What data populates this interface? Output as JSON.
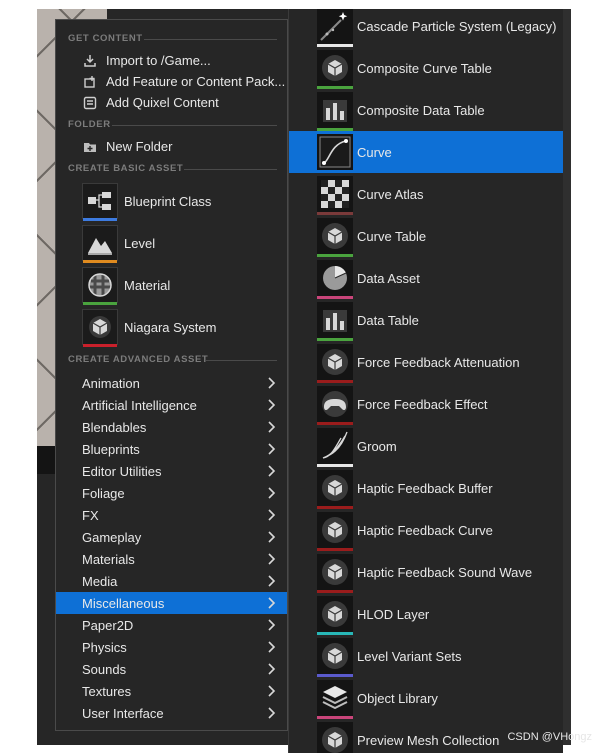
{
  "main_menu": {
    "sections": {
      "get_content": "GET CONTENT",
      "folder": "FOLDER",
      "create_basic": "CREATE BASIC ASSET",
      "create_advanced": "CREATE ADVANCED ASSET"
    },
    "get_content_items": [
      {
        "label": "Import to /Game...",
        "icon": "import-icon"
      },
      {
        "label": "Add Feature or Content Pack...",
        "icon": "feature-pack-icon"
      },
      {
        "label": "Add Quixel Content",
        "icon": "quixel-icon"
      }
    ],
    "folder_items": [
      {
        "label": "New Folder",
        "icon": "new-folder-icon"
      }
    ],
    "basic_assets": [
      {
        "label": "Blueprint Class",
        "icon": "blueprint-icon",
        "color": "#3d7be0"
      },
      {
        "label": "Level",
        "icon": "level-icon",
        "color": "#e08b1f"
      },
      {
        "label": "Material",
        "icon": "material-icon",
        "color": "#4aa33e"
      },
      {
        "label": "Niagara System",
        "icon": "niagara-icon",
        "color": "#c9202b"
      }
    ],
    "advanced_categories": [
      {
        "label": "Animation"
      },
      {
        "label": "Artificial Intelligence"
      },
      {
        "label": "Blendables"
      },
      {
        "label": "Blueprints"
      },
      {
        "label": "Editor Utilities"
      },
      {
        "label": "Foliage"
      },
      {
        "label": "FX"
      },
      {
        "label": "Gameplay"
      },
      {
        "label": "Materials"
      },
      {
        "label": "Media"
      },
      {
        "label": "Miscellaneous",
        "selected": true
      },
      {
        "label": "Paper2D"
      },
      {
        "label": "Physics"
      },
      {
        "label": "Sounds"
      },
      {
        "label": "Textures"
      },
      {
        "label": "User Interface"
      }
    ]
  },
  "sub_menu": {
    "items": [
      {
        "label": "Cascade Particle System (Legacy)",
        "icon": "particle-icon",
        "color": "#e8e8e8"
      },
      {
        "label": "Composite Curve Table",
        "icon": "sphere-icon",
        "color": "#4aa33e"
      },
      {
        "label": "Composite Data Table",
        "icon": "bar-chart-icon",
        "color": "#4aa33e"
      },
      {
        "label": "Curve",
        "icon": "curve-icon",
        "color": "#0e70d6",
        "selected": true
      },
      {
        "label": "Curve Atlas",
        "icon": "checker-icon",
        "color": "#7a3a3a"
      },
      {
        "label": "Curve Table",
        "icon": "sphere-icon",
        "color": "#4aa33e"
      },
      {
        "label": "Data Asset",
        "icon": "pie-icon",
        "color": "#c9457a"
      },
      {
        "label": "Data Table",
        "icon": "bar-chart-icon",
        "color": "#4aa33e"
      },
      {
        "label": "Force Feedback Attenuation",
        "icon": "sphere-icon",
        "color": "#9a1c1c"
      },
      {
        "label": "Force Feedback Effect",
        "icon": "gamepad-icon",
        "color": "#9a1c1c"
      },
      {
        "label": "Groom",
        "icon": "groom-icon",
        "color": "#e8e8e8"
      },
      {
        "label": "Haptic Feedback Buffer",
        "icon": "sphere-icon",
        "color": "#9a1c1c"
      },
      {
        "label": "Haptic Feedback Curve",
        "icon": "sphere-icon",
        "color": "#9a1c1c"
      },
      {
        "label": "Haptic Feedback Sound Wave",
        "icon": "sphere-icon",
        "color": "#9a1c1c"
      },
      {
        "label": "HLOD Layer",
        "icon": "sphere-icon",
        "color": "#28b7b7"
      },
      {
        "label": "Level Variant Sets",
        "icon": "sphere-icon",
        "color": "#5a5acc"
      },
      {
        "label": "Object Library",
        "icon": "library-icon",
        "color": "#c9457a"
      },
      {
        "label": "Preview Mesh Collection",
        "icon": "sphere-icon",
        "color": "#4aa33e"
      }
    ]
  },
  "watermark": "CSDN @VHongz"
}
